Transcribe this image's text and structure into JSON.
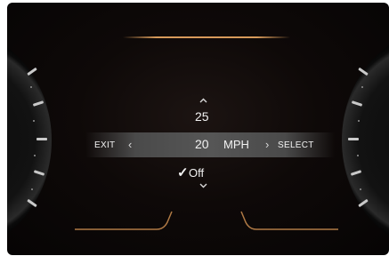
{
  "selector": {
    "up_arrow_icon": "chevron-up-icon",
    "prev_value": "25",
    "exit_label": "EXIT",
    "exit_chevron": "‹",
    "current_value": "20",
    "unit": "MPH",
    "select_chevron": "›",
    "select_label": "SELECT",
    "check_mark": "✓",
    "option_label": "Off",
    "down_arrow_icon": "chevron-down-icon"
  },
  "colors": {
    "accent_copper": "#d79a5a",
    "text": "#f2f2f2",
    "band": "#565656"
  }
}
